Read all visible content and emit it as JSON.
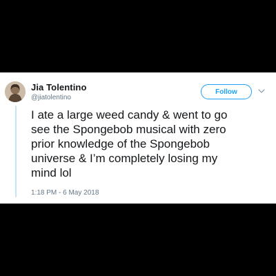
{
  "tweet": {
    "author": {
      "display_name": "Jia Tolentino",
      "handle": "@jiatolentino"
    },
    "follow_label": "Follow",
    "text": "I ate a large weed candy & went to go\nsee the Spongebob musical with zero\nprior knowledge of the Spongebob\nuniverse & I’m completely losing my\nmind lol",
    "timestamp": "1:18 PM - 6 May 2018"
  },
  "icons": {
    "avatar": "avatar-icon",
    "more_options": "chevron-down-icon"
  },
  "colors": {
    "background": "#000000",
    "card": "#ffffff",
    "accent": "#1da1f2",
    "text_primary": "#14171a",
    "text_secondary": "#657786"
  }
}
